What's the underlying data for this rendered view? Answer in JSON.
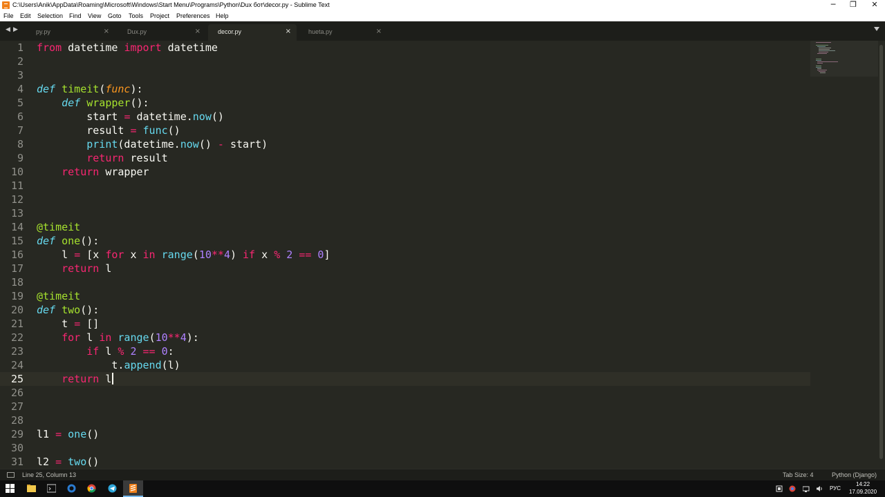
{
  "window": {
    "title": "C:\\Users\\Anik\\AppData\\Roaming\\Microsoft\\Windows\\Start Menu\\Programs\\Python\\Dux бот\\decor.py - Sublime Text",
    "minimize": "─",
    "restore": "❐",
    "close": "✕"
  },
  "menu": [
    "File",
    "Edit",
    "Selection",
    "Find",
    "View",
    "Goto",
    "Tools",
    "Project",
    "Preferences",
    "Help"
  ],
  "tabs": {
    "nav_back": "◀",
    "nav_forward": "▶",
    "items": [
      {
        "label": "py.py",
        "close": "×"
      },
      {
        "label": "Dux.py",
        "close": "×"
      },
      {
        "label": "decor.py",
        "close": "×",
        "active": true
      },
      {
        "label": "hueta.py",
        "close": "×"
      }
    ]
  },
  "editor": {
    "current_line": 25,
    "line_numbers": [
      "1",
      "2",
      "3",
      "4",
      "5",
      "6",
      "7",
      "8",
      "9",
      "10",
      "11",
      "12",
      "13",
      "14",
      "15",
      "16",
      "17",
      "18",
      "19",
      "20",
      "21",
      "22",
      "23",
      "24",
      "25",
      "26",
      "27",
      "28",
      "29",
      "30",
      "31"
    ],
    "code": {
      "l1_from": "from",
      "l1_m": " datetime ",
      "l1_import": "import",
      "l1_name": " datetime",
      "l4_def": "def",
      "l4_fn": "timeit",
      "l4_p1": "(",
      "l4_param": "func",
      "l4_p2": "):",
      "l5_def": "def",
      "l5_fn": "wrapper",
      "l5_p": "():",
      "l6_a": "start ",
      "l6_eq": "=",
      "l6_b": " datetime.",
      "l6_now": "now",
      "l6_c": "()",
      "l7_a": "result ",
      "l7_eq": "=",
      "l7_sp": " ",
      "l7_fn": "func",
      "l7_c": "()",
      "l8_print": "print",
      "l8_a": "(datetime.",
      "l8_now": "now",
      "l8_b": "() ",
      "l8_minus": "-",
      "l8_c": " start)",
      "l9_ret": "return",
      "l9_a": " result",
      "l10_ret": "return",
      "l10_a": " wrapper",
      "l14_dec": "@timeit",
      "l15_def": "def",
      "l15_fn": "one",
      "l15_p": "():",
      "l16_a": "l ",
      "l16_eq": "=",
      "l16_b": " [x ",
      "l16_for": "for",
      "l16_c": " x ",
      "l16_in": "in",
      "l16_sp": " ",
      "l16_range": "range",
      "l16_d": "(",
      "l16_n1": "10",
      "l16_pow": "**",
      "l16_n2": "4",
      "l16_e": ") ",
      "l16_if": "if",
      "l16_f": " x ",
      "l16_mod": "%",
      "l16_sp2": " ",
      "l16_n3": "2",
      "l16_sp3": " ",
      "l16_eqeq": "==",
      "l16_sp4": " ",
      "l16_n4": "0",
      "l16_g": "]",
      "l17_ret": "return",
      "l17_a": " l",
      "l19_dec": "@timeit",
      "l20_def": "def",
      "l20_fn": "two",
      "l20_p": "():",
      "l21_a": "t ",
      "l21_eq": "=",
      "l21_b": " []",
      "l22_for": "for",
      "l22_a": " l ",
      "l22_in": "in",
      "l22_sp": " ",
      "l22_range": "range",
      "l22_b": "(",
      "l22_n1": "10",
      "l22_pow": "**",
      "l22_n2": "4",
      "l22_c": "):",
      "l23_if": "if",
      "l23_a": " l ",
      "l23_mod": "%",
      "l23_sp": " ",
      "l23_n1": "2",
      "l23_sp2": " ",
      "l23_eqeq": "==",
      "l23_sp3": " ",
      "l23_n2": "0",
      "l23_b": ":",
      "l24_a": "t.",
      "l24_append": "append",
      "l24_b": "(l)",
      "l25_ret": "return",
      "l25_a": " l",
      "l29_a": "l1 ",
      "l29_eq": "=",
      "l29_sp": " ",
      "l29_fn": "one",
      "l29_b": "()",
      "l31_a": "l2 ",
      "l31_eq": "=",
      "l31_sp": " ",
      "l31_fn": "two",
      "l31_b": "()"
    }
  },
  "status": {
    "position": "Line 25, Column 13",
    "tab_size": "Tab Size: 4",
    "syntax": "Python (Django)"
  },
  "taskbar": {
    "language": "РУС",
    "time": "14:22",
    "date": "17.09.2020"
  },
  "colors": {
    "keyword": "#f92672",
    "storage": "#66d9ef",
    "function": "#a6e22e",
    "number": "#ae81ff",
    "parameter": "#fd971f",
    "text": "#f8f8f2",
    "background": "#272822"
  }
}
